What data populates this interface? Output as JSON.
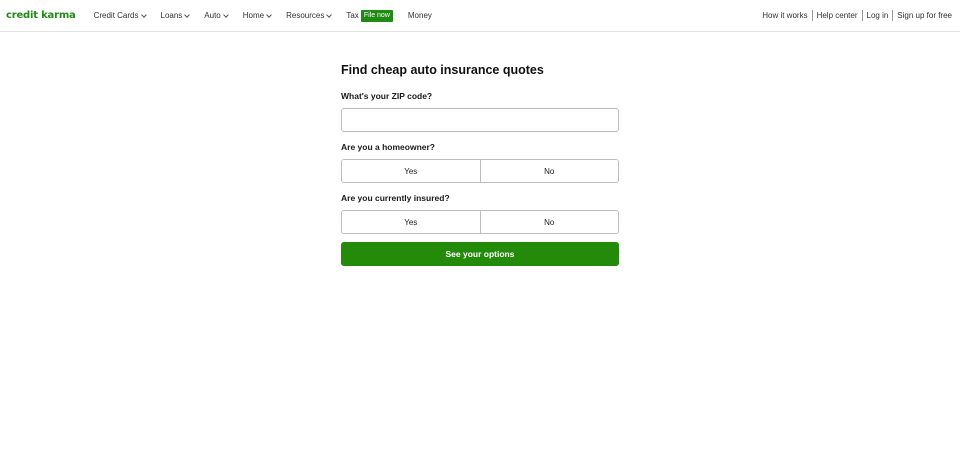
{
  "header": {
    "logo": "credit karma",
    "nav": [
      {
        "label": "Credit Cards",
        "has_dropdown": true
      },
      {
        "label": "Loans",
        "has_dropdown": true
      },
      {
        "label": "Auto",
        "has_dropdown": true
      },
      {
        "label": "Home",
        "has_dropdown": true
      },
      {
        "label": "Resources",
        "has_dropdown": true
      }
    ],
    "tax": {
      "label": "Tax",
      "badge": "File now"
    },
    "money": "Money",
    "right_links": [
      "How it works",
      "Help center",
      "Log in",
      "Sign up for free"
    ]
  },
  "form": {
    "title": "Find cheap auto insurance quotes",
    "zip_label": "What's your ZIP code?",
    "zip_value": "",
    "zip_placeholder": "",
    "homeowner": {
      "label": "Are you a homeowner?",
      "yes": "Yes",
      "no": "No"
    },
    "insured": {
      "label": "Are you currently insured?",
      "yes": "Yes",
      "no": "No"
    },
    "submit": "See your options"
  },
  "colors": {
    "brand_green": "#1f8a14",
    "cta_green": "#248a0a",
    "border": "#bdbdbd"
  }
}
